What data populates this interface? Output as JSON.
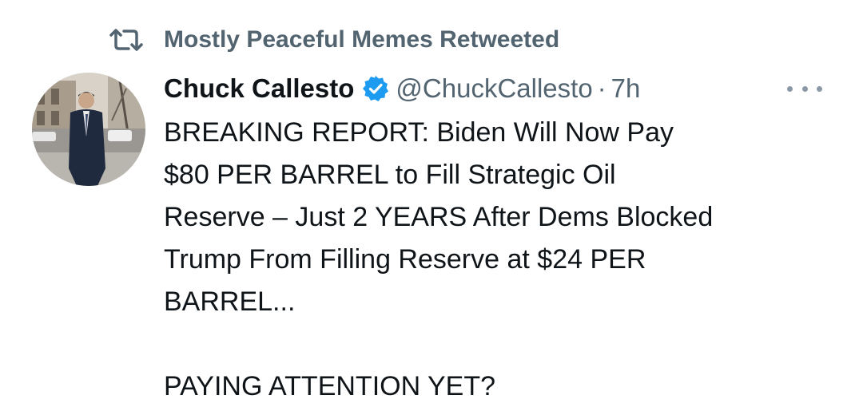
{
  "retweet": {
    "icon": "retweet-icon",
    "text": "Mostly Peaceful Memes Retweeted"
  },
  "author": {
    "display_name": "Chuck Callesto",
    "verified_icon": "verified-badge-icon",
    "verified_color": "#1d9bf0",
    "handle": "@ChuckCallesto",
    "separator": "·",
    "time": "7h"
  },
  "more_icon": "more-options-icon",
  "tweet": {
    "lines": [
      "BREAKING REPORT: Biden Will Now Pay",
      "$80 PER BARREL to Fill Strategic Oil",
      "Reserve – Just 2 YEARS After Dems Blocked",
      "Trump From Filling Reserve at $24 PER",
      "BARREL...",
      "PAYING ATTENTION YET?"
    ]
  },
  "colors": {
    "text_primary": "#0f1419",
    "text_secondary": "#536471",
    "background": "#ffffff"
  }
}
